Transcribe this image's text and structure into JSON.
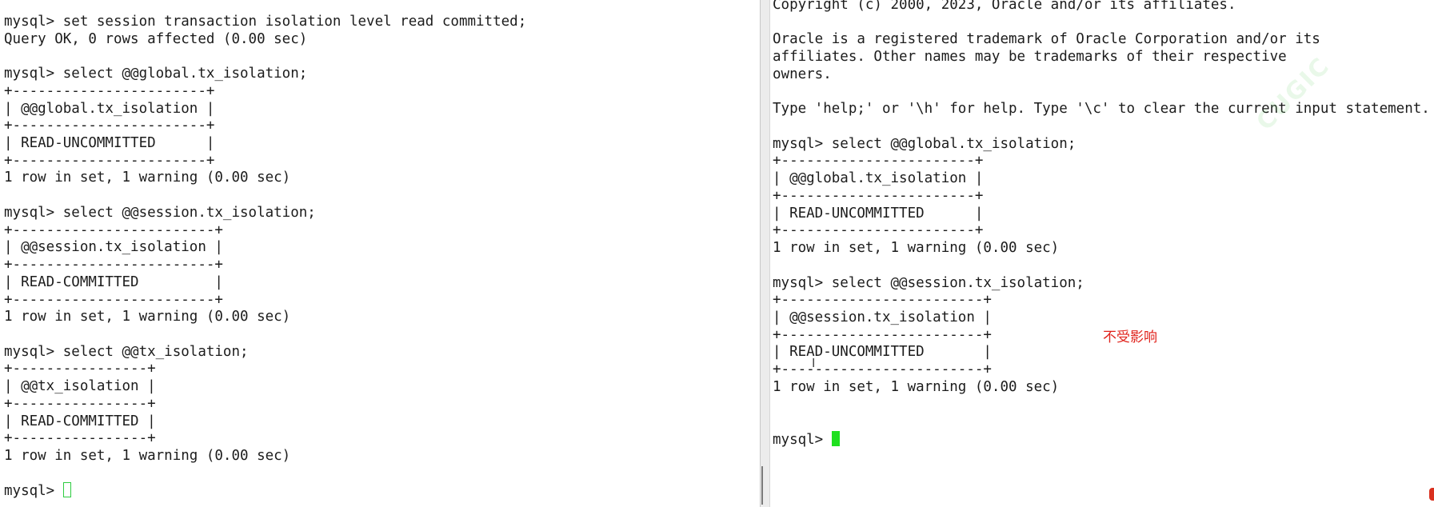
{
  "left_terminal": {
    "lines": [
      "mysql> set session transaction isolation level read committed;",
      "Query OK, 0 rows affected (0.00 sec)",
      "",
      "mysql> select @@global.tx_isolation;",
      "+-----------------------+",
      "| @@global.tx_isolation |",
      "+-----------------------+",
      "| READ-UNCOMMITTED      |",
      "+-----------------------+",
      "1 row in set, 1 warning (0.00 sec)",
      "",
      "mysql> select @@session.tx_isolation;",
      "+------------------------+",
      "| @@session.tx_isolation |",
      "+------------------------+",
      "| READ-COMMITTED         |",
      "+------------------------+",
      "1 row in set, 1 warning (0.00 sec)",
      "",
      "mysql> select @@tx_isolation;",
      "+----------------+",
      "| @@tx_isolation |",
      "+----------------+",
      "| READ-COMMITTED |",
      "+----------------+",
      "1 row in set, 1 warning (0.00 sec)",
      ""
    ],
    "prompt": "mysql> "
  },
  "right_terminal": {
    "lines": [
      "Copyright (c) 2000, 2023, Oracle and/or its affiliates.",
      "",
      "Oracle is a registered trademark of Oracle Corporation and/or its",
      "affiliates. Other names may be trademarks of their respective",
      "owners.",
      "",
      "Type 'help;' or '\\h' for help. Type '\\c' to clear the current input statement.",
      "",
      "mysql> select @@global.tx_isolation;",
      "+-----------------------+",
      "| @@global.tx_isolation |",
      "+-----------------------+",
      "| READ-UNCOMMITTED      |",
      "+-----------------------+",
      "1 row in set, 1 warning (0.00 sec)",
      "",
      "mysql> select @@session.tx_isolation;",
      "+------------------------+",
      "| @@session.tx_isolation |",
      "+------------------------+",
      "| READ-UNCOMMITTED       |",
      "+------------------------+",
      "1 row in set, 1 warning (0.00 sec)",
      ""
    ],
    "prompt": "mysql> "
  },
  "annotation": {
    "text": "不受影响",
    "color": "#e0231c"
  },
  "colors": {
    "cursor_active": "#1fe01f",
    "cursor_inactive": "#2ecc40",
    "text": "#1c1c1c",
    "background": "#ffffff"
  },
  "cursor_icon": "text-ibeam-icon",
  "ibeam_glyph": "I"
}
